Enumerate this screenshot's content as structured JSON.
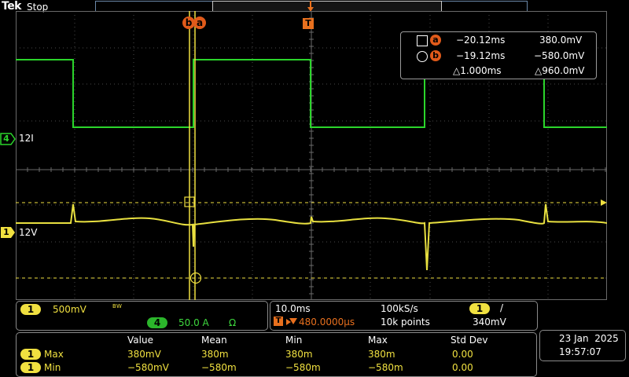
{
  "header": {
    "brand": "Tek",
    "run_state": "Stop",
    "trigger_marker": "T"
  },
  "cursors": {
    "tag_b": "b",
    "tag_a": "a"
  },
  "readout": {
    "a_time": "−20.12ms",
    "a_value": "380.0mV",
    "b_time": "−19.12ms",
    "b_value": "−580.0mV",
    "delta_time": "△1.000ms",
    "delta_value": "△960.0mV",
    "tag_a": "a",
    "tag_b": "b"
  },
  "channels": {
    "ch4": {
      "number": "4",
      "label": "12I",
      "color": "#2bb52b"
    },
    "ch1": {
      "number": "1",
      "label": "12V",
      "color": "#f0e040"
    }
  },
  "vertical_panel": {
    "ch1_number": "1",
    "ch1_scale": "500mV",
    "bw_mark": "B W",
    "ch4_number": "4",
    "ch4_scale": "50.0 A",
    "ohm_symbol": "Ω"
  },
  "horizontal_panel": {
    "timebase": "10.0ms",
    "sample_rate": "100kS/s",
    "trig_source": "1",
    "trig_slope": "/",
    "trig_position_icon": "T",
    "trig_position": "480.0000µs",
    "record_length": "10k points",
    "trig_level": "340mV"
  },
  "measurements": {
    "headers": [
      "Value",
      "Mean",
      "Min",
      "Max",
      "Std Dev"
    ],
    "rows": [
      {
        "source": "1",
        "name": "Max",
        "values": [
          "380mV",
          "380m",
          "380m",
          "380m",
          "0.00"
        ]
      },
      {
        "source": "1",
        "name": "Min",
        "values": [
          "−580mV",
          "−580m",
          "−580m",
          "−580m",
          "0.00"
        ]
      }
    ]
  },
  "datetime": {
    "date": "23 Jan  2025",
    "time": "19:57:07"
  }
}
